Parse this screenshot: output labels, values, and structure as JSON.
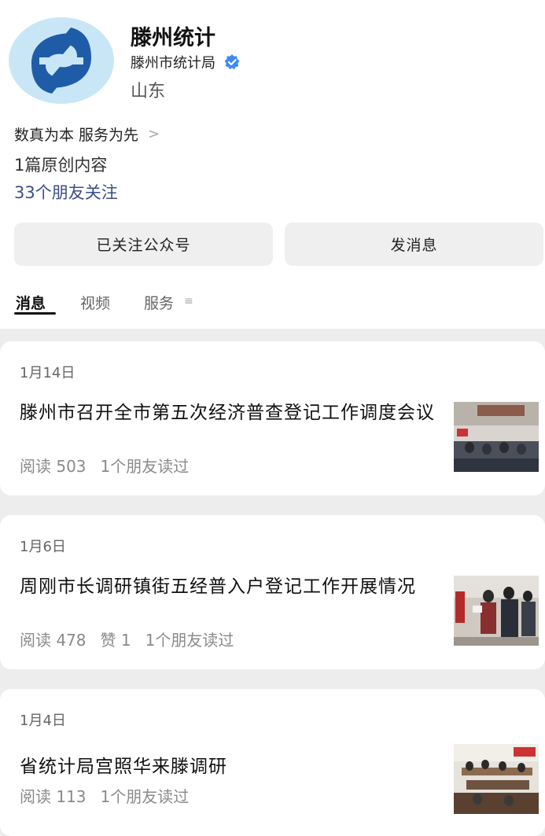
{
  "account": {
    "name": "滕州统计",
    "org": "滕州市统计局",
    "region": "山东",
    "motto": "数真为本 服务为先",
    "original": "1篇原创内容",
    "friends": "33个朋友关注"
  },
  "buttons": {
    "follow": "已关注公众号",
    "message": "发消息"
  },
  "tabs": [
    "消息",
    "视频",
    "服务"
  ],
  "articles": [
    {
      "date": "1月14日",
      "title": "滕州市召开全市第五次经济普查登记工作调度会议",
      "meta": [
        "阅读 503",
        "1个朋友读过"
      ]
    },
    {
      "date": "1月6日",
      "title": "周刚市长调研镇街五经普入户登记工作开展情况",
      "meta": [
        "阅读 478",
        "赞 1",
        "1个朋友读过"
      ]
    },
    {
      "date": "1月4日",
      "title": "省统计局宫照华来滕调研",
      "meta": [
        "阅读 113",
        "1个朋友读过"
      ]
    }
  ],
  "colors": {
    "link": "#3a4f86",
    "verified": "#3d8af7",
    "logo_blue": "#1f5ca8",
    "logo_bg": "#bfe0f3"
  }
}
